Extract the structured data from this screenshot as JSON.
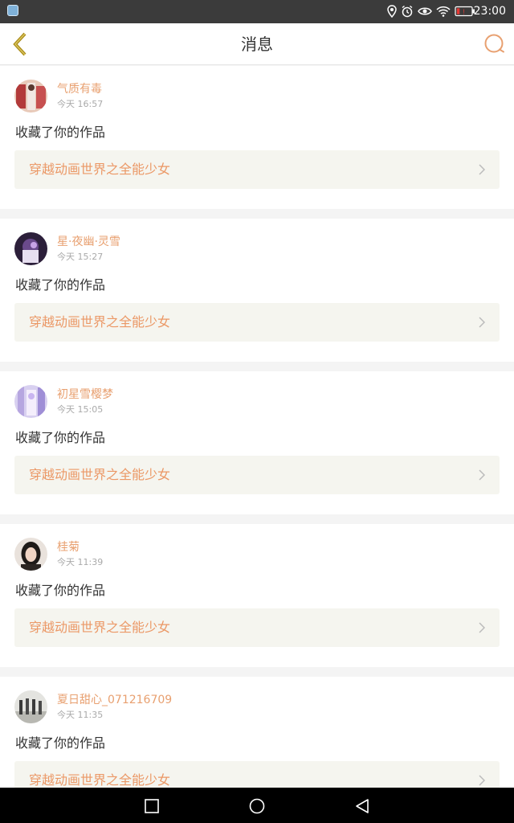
{
  "status_bar": {
    "time": "23:00",
    "icons": [
      "app-icon",
      "location-icon",
      "alarm-icon",
      "eye-icon",
      "wifi-icon",
      "battery-low-icon"
    ],
    "battery_color": "#e53935"
  },
  "nav": {
    "title": "消息",
    "back_icon": "chevron-left-icon",
    "search_icon": "search-icon",
    "accent": "#e8a070"
  },
  "messages": [
    {
      "username": "气质有毒",
      "time": "今天 16:57",
      "action": "收藏了你的作品",
      "work_title": "穿越动画世界之全能少女"
    },
    {
      "username": "星·夜幽·灵雪",
      "time": "今天 15:27",
      "action": "收藏了你的作品",
      "work_title": "穿越动画世界之全能少女"
    },
    {
      "username": "初星雪樱梦",
      "time": "今天 15:05",
      "action": "收藏了你的作品",
      "work_title": "穿越动画世界之全能少女"
    },
    {
      "username": "桂菊",
      "time": "今天 11:39",
      "action": "收藏了你的作品",
      "work_title": "穿越动画世界之全能少女"
    },
    {
      "username": "夏日甜心_071216709",
      "time": "今天 11:35",
      "action": "收藏了你的作品",
      "work_title": "穿越动画世界之全能少女"
    }
  ],
  "system_nav": {
    "recents_icon": "square-icon",
    "home_icon": "circle-icon",
    "back_icon": "triangle-back-icon"
  }
}
